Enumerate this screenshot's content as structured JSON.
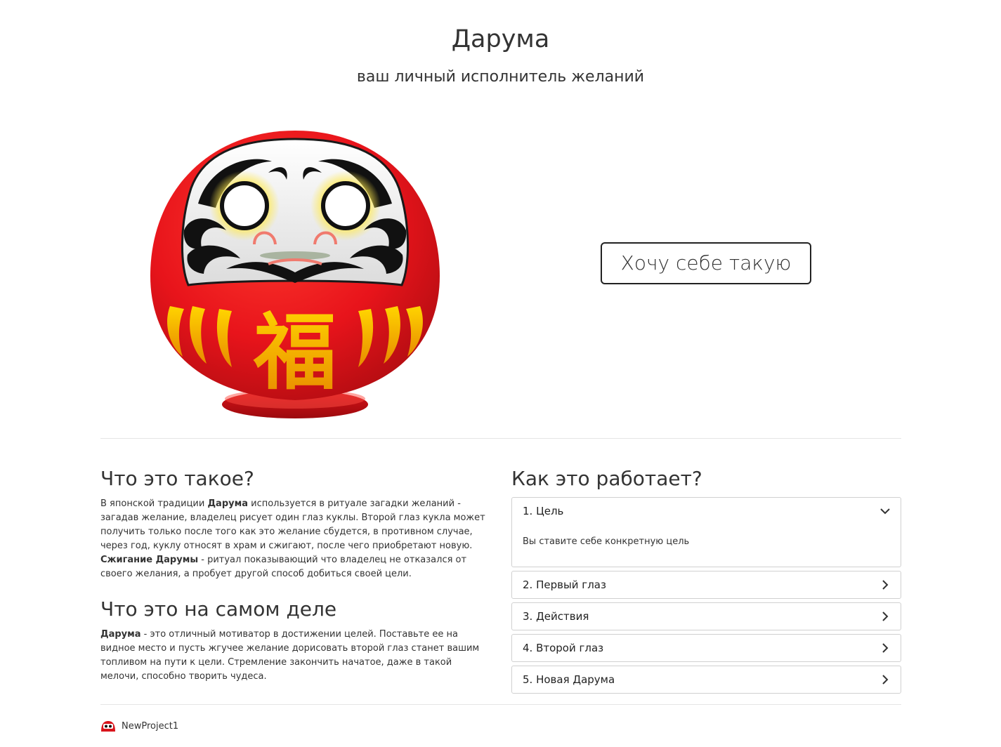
{
  "header": {
    "title": "Дарума",
    "subtitle": "ваш личный исполнитель желаний"
  },
  "hero": {
    "image_name": "daruma-doll",
    "kanji": "福",
    "cta_label": "Хочу себе такую"
  },
  "about": {
    "heading": "Что это такое?",
    "para_parts": [
      "В японской традиции ",
      "Дарума",
      " используется в ритуале загадки желаний - загадав желание, владелец рисует один глаз куклы. Второй глаз кукла может получить только после того как это желание сбудется, в противном случае, через год, куклу относят в храм и сжигают, после чего приобретают новую. ",
      "Сжигание Дарумы",
      " - ритуал показывающий что владелец не отказался от своего желания, а пробует другой способ добиться своей цели."
    ]
  },
  "reality": {
    "heading": "Что это на самом деле",
    "para_parts": [
      "Дарума",
      " - это отличный мотиватор в достижении целей. Поставьте ее на видное место и пусть жгучее желание дорисовать второй глаз станет вашим топливом на пути к цели. Стремление закончить начатое, даже в такой мелочи, способно творить чудеса."
    ]
  },
  "how": {
    "heading": "Как это работает?",
    "items": [
      {
        "label": "1. Цель",
        "expanded": true,
        "body": "Вы ставите себе конкретную цель"
      },
      {
        "label": "2. Первый глаз",
        "expanded": false
      },
      {
        "label": "3. Действия",
        "expanded": false
      },
      {
        "label": "4. Второй глаз",
        "expanded": false
      },
      {
        "label": "5. Новая Дарума",
        "expanded": false
      }
    ]
  },
  "footer": {
    "brand": "NewProject1"
  },
  "colors": {
    "doll_red": "#e8141b",
    "doll_gold": "#f5b800",
    "text": "#333333",
    "border": "#d0d0d0"
  }
}
